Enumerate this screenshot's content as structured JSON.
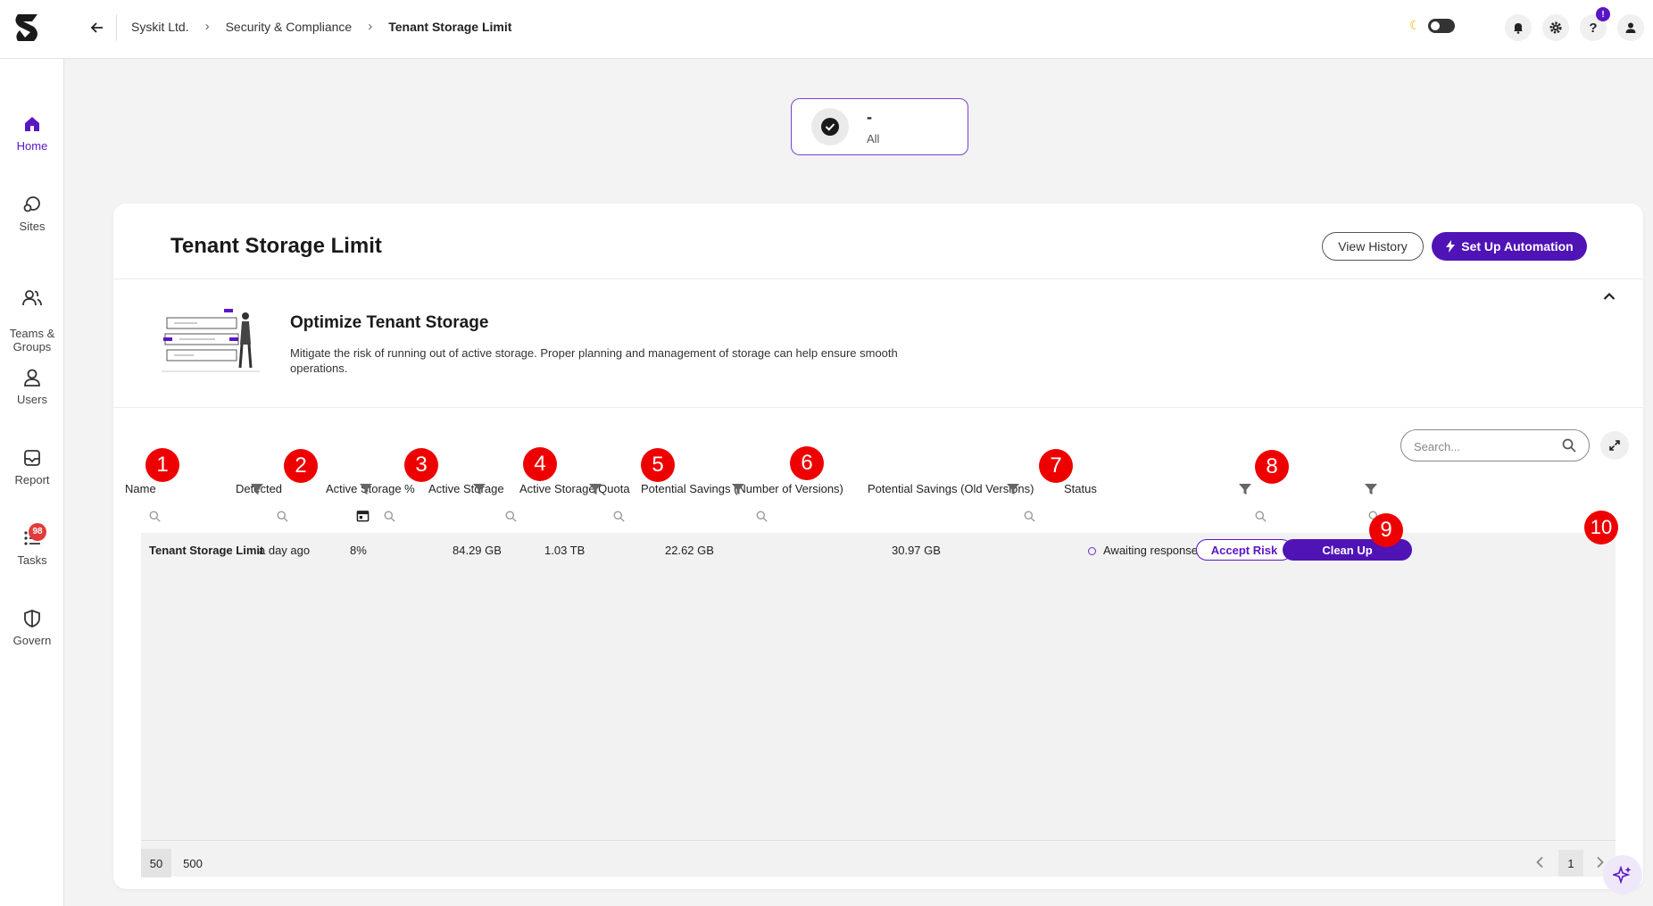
{
  "breadcrumbs": [
    "Syskit Ltd.",
    "Security & Compliance",
    "Tenant Storage Limit"
  ],
  "topbar": {
    "alert_badge": "!",
    "icons": [
      "bell-icon",
      "gear-icon",
      "help-icon",
      "user-icon"
    ]
  },
  "sidebar": {
    "items": [
      {
        "label": "Home",
        "icon": "home-icon",
        "active": true
      },
      {
        "label": "Sites",
        "icon": "sites-icon"
      },
      {
        "label": "Teams &\nGroups",
        "icon": "teams-icon"
      },
      {
        "label": "Users",
        "icon": "user-icon"
      },
      {
        "label": "Report",
        "icon": "report-icon"
      },
      {
        "label": "Tasks",
        "icon": "tasks-icon",
        "badge": "98"
      },
      {
        "label": "Govern",
        "icon": "shield-icon"
      }
    ]
  },
  "filter_card": {
    "value": "-",
    "label": "All"
  },
  "card": {
    "title": "Tenant Storage Limit",
    "view_history": "View History",
    "automation": "Set Up Automation",
    "info_title": "Optimize Tenant Storage",
    "info_desc": "Mitigate the risk of running out of active storage. Proper planning and management of storage can help ensure smooth operations."
  },
  "search": {
    "placeholder": "Search..."
  },
  "table": {
    "columns": [
      "Name",
      "Detected",
      "Active Storage %",
      "Active Storage",
      "Active Storage Quota",
      "Potential Savings (Number of Versions)",
      "Potential Savings (Old Versions)",
      "Status"
    ],
    "rows": [
      {
        "name": "Tenant Storage Limit",
        "detected": "a day ago",
        "active_pct": "8%",
        "active": "84.29 GB",
        "quota": "1.03 TB",
        "savings_versions": "22.62 GB",
        "savings_old": "30.97 GB",
        "status": "Awaiting response",
        "accept": "Accept Risk",
        "clean": "Clean Up"
      }
    ]
  },
  "pager": {
    "sizes": [
      "50",
      "500"
    ],
    "page": "1"
  },
  "markers": [
    "1",
    "2",
    "3",
    "4",
    "5",
    "6",
    "7",
    "8",
    "9",
    "10"
  ],
  "colors": {
    "accent": "#4f13b6",
    "marker": "#ee0000",
    "badge": "#e23b3b"
  }
}
